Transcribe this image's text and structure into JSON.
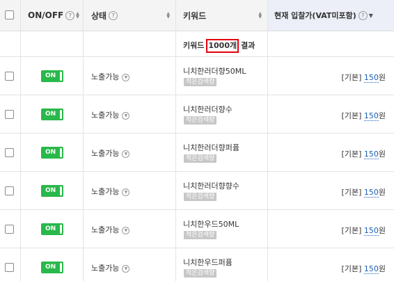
{
  "header": {
    "onoff_label": "ON/OFF",
    "status_label": "상태",
    "keyword_label": "키워드",
    "bid_label": "현재 입찰가(VAT미포함)",
    "help_glyph": "?"
  },
  "summary": {
    "prefix": "키워드",
    "count": "1000개",
    "suffix": "결과"
  },
  "rows": [
    {
      "toggle": "ON",
      "status": "노출가능",
      "keyword": "니치한러더향50ML",
      "badge": "적은검색량",
      "bid_label": "[기본]",
      "bid_value": "150",
      "bid_unit": "원"
    },
    {
      "toggle": "ON",
      "status": "노출가능",
      "keyword": "니치한러더향수",
      "badge": "적은검색량",
      "bid_label": "[기본]",
      "bid_value": "150",
      "bid_unit": "원"
    },
    {
      "toggle": "ON",
      "status": "노출가능",
      "keyword": "니치한러더향퍼퓸",
      "badge": "적은검색량",
      "bid_label": "[기본]",
      "bid_value": "150",
      "bid_unit": "원"
    },
    {
      "toggle": "ON",
      "status": "노출가능",
      "keyword": "니치한러더향향수",
      "badge": "적은검색량",
      "bid_label": "[기본]",
      "bid_value": "150",
      "bid_unit": "원"
    },
    {
      "toggle": "ON",
      "status": "노출가능",
      "keyword": "니치한우드50ML",
      "badge": "적은검색량",
      "bid_label": "[기본]",
      "bid_value": "150",
      "bid_unit": "원"
    },
    {
      "toggle": "ON",
      "status": "노출가능",
      "keyword": "니치한우드퍼퓸",
      "badge": "적은검색량",
      "bid_label": "[기본]",
      "bid_value": "150",
      "bid_unit": "원"
    }
  ],
  "colors": {
    "toggle_on": "#29b84a",
    "highlight_border": "#e3000f",
    "bid_link": "#1a5fb4",
    "badge_bg": "#c7c7c7"
  }
}
